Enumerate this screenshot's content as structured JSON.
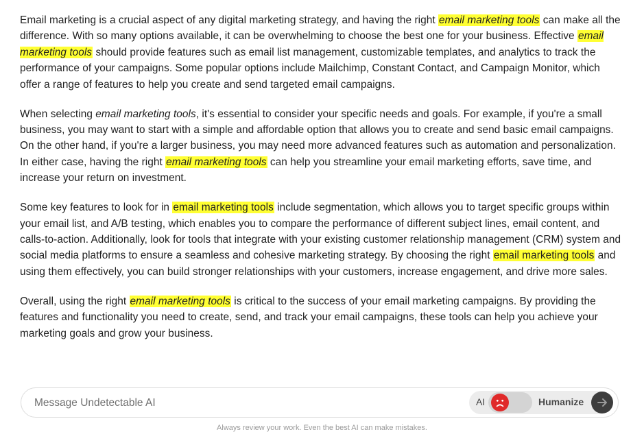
{
  "article": {
    "p1": {
      "s1": "Email marketing is a crucial aspect of any digital marketing strategy, and having the right ",
      "kw1": "email marketing tools",
      "s2": " can make all the difference. With so many options available, it can be overwhelming to choose the best one for your business. Effective ",
      "kw2": "email marketing tools",
      "s3": " should provide features such as email list management, customizable templates, and analytics to track the performance of your campaigns. Some popular options include Mailchimp, Constant Contact, and Campaign Monitor, which offer a range of features to help you create and send targeted email campaigns."
    },
    "p2": {
      "s1": "When selecting ",
      "kw1": "email marketing tools",
      "s2": ", it's essential to consider your specific needs and goals. For example, if you're a small business, you may want to start with a simple and affordable option that allows you to create and send basic email campaigns. On the other hand, if you're a larger business, you may need more advanced features such as automation and personalization. In either case, having the right ",
      "kw2": "email marketing tools",
      "s3": " can help you streamline your email marketing efforts, save time, and increase your return on investment."
    },
    "p3": {
      "s1": "Some key features to look for in ",
      "kw1": "email marketing tools",
      "s2": " include segmentation, which allows you to target specific groups within your email list, and A/B testing, which enables you to compare the performance of different subject lines, email content, and calls-to-action. Additionally, look for tools that integrate with your existing customer relationship management (CRM) system and social media platforms to ensure a seamless and cohesive marketing strategy. By choosing the right ",
      "kw2": "email marketing tools",
      "s3": " and using them effectively, you can build stronger relationships with your customers, increase engagement, and drive more sales."
    },
    "p4": {
      "s1": "Overall, using the right ",
      "kw1": "email marketing tools",
      "s2": " is critical to the success of your email marketing campaigns. By providing the features and functionality you need to create, send, and track your email campaigns, these tools can help you achieve your marketing goals and grow your business."
    }
  },
  "composer": {
    "placeholder": "Message Undetectable AI",
    "value": "",
    "toggle": {
      "left_label": "AI",
      "right_label": "Humanize",
      "state": "AI",
      "knob_icon": "sad-face-icon"
    },
    "send_icon": "arrow-right-icon"
  },
  "disclaimer": "Always review your work. Even the best AI can make mistakes.",
  "colors": {
    "highlight": "#ffff33",
    "knob": "#e02a2a",
    "send_button": "#3d3d3d"
  }
}
